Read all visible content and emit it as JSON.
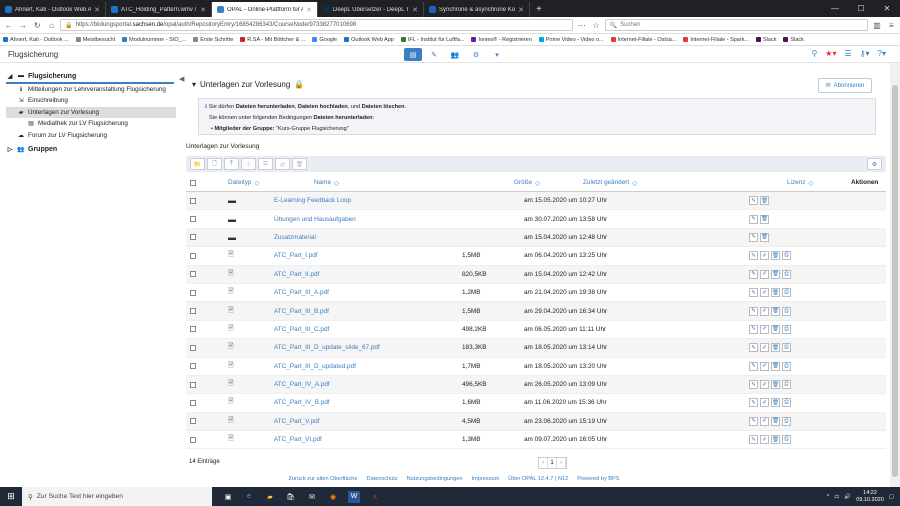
{
  "browser": {
    "tabs": [
      {
        "title": "Ahnert, Kati - Outlook Web Ap",
        "active": false,
        "color": "#1e73c8"
      },
      {
        "title": "ATC_Holding_Pattern.wmv / Mi",
        "active": false,
        "color": "#1976d2"
      },
      {
        "title": "OPAL - Online-Plattform für Ak",
        "active": true,
        "color": "#3a7fc1"
      },
      {
        "title": "DeepL Übersetzer - DeepL Tran",
        "active": false,
        "color": "#0f2b46"
      },
      {
        "title": "Synchrone & asynchrone Komm",
        "active": false,
        "color": "#1565c0"
      }
    ],
    "url_prefix": "https://bildungsportal.",
    "url_domain": "sachsen.de",
    "url_path": "/opal/auth/RepositoryEntry/16854286343/CourseNode/97338277010698",
    "search_placeholder": "Suchen",
    "bookmarks": [
      {
        "label": "Ahnert, Kati - Outlook ...",
        "color": "#1e73c8"
      },
      {
        "label": "Meistbesucht",
        "color": "#888888"
      },
      {
        "label": "Modulnummer - StO_...",
        "color": "#3a7fc1"
      },
      {
        "label": "Erste Schritte",
        "color": "#888888"
      },
      {
        "label": "R.SA - Mit Böttcher & ...",
        "color": "#c62828"
      },
      {
        "label": "Google",
        "color": "#4285f4"
      },
      {
        "label": "Outlook Web App",
        "color": "#1e73c8"
      },
      {
        "label": "IFL - Institut für Luftfa...",
        "color": "#2e7d32"
      },
      {
        "label": "Ionies® - Registrieren",
        "color": "#6a1b9a"
      },
      {
        "label": "Prime Video - Video o...",
        "color": "#00a8e1"
      },
      {
        "label": "Internet-Filiale - Ostsä...",
        "color": "#e53935"
      },
      {
        "label": "Internet-Filiale - Spark...",
        "color": "#e53935"
      },
      {
        "label": "Slack",
        "color": "#4a154b"
      },
      {
        "label": "Slack",
        "color": "#4a154b"
      }
    ]
  },
  "app": {
    "course_title": "Flugsicherung"
  },
  "sidebar": {
    "root": "Flugsicherung",
    "items": [
      {
        "label": "Mitteilungen zur Lehrveranstaltung Flugsicherung",
        "icon": "info-icon",
        "level": 1
      },
      {
        "label": "Einschreibung",
        "icon": "enroll-icon",
        "level": 1
      },
      {
        "label": "Unterlagen zur Vorlesung",
        "icon": "folder-icon",
        "level": 1,
        "selected": true
      },
      {
        "label": "Mediathek zur LV Flugsicherung",
        "icon": "media-icon",
        "level": 2
      },
      {
        "label": "Forum zur LV Flugsicherung",
        "icon": "forum-icon",
        "level": 1
      }
    ],
    "groups": "Gruppen"
  },
  "content": {
    "title": "Unterlagen zur Vorlesung",
    "subscribe_label": "Abonnieren",
    "info_line1_pre": "Sie dürfen ",
    "info_line1_b1": "Dateien herunterladen",
    "info_line1_sep1": ", ",
    "info_line1_b2": "Dateien hochladen",
    "info_line1_sep2": ", und ",
    "info_line1_b3": "Dateien löschen",
    "info_line1_end": ".",
    "info_line2_pre": "Sie können unter folgenden Bedingungen ",
    "info_line2_b": "Dateien herunterladen",
    "info_line2_end": ":",
    "info_line3_b": "Mitglieder der Gruppe:",
    "info_line3_rest": " \"Kurs-Gruppe Flugsicherung\"",
    "table_label": "Unterlagen zur Vorlesung",
    "columns": {
      "type": "Dateityp",
      "name": "Name",
      "size": "Größe",
      "date": "Zuletzt geändert",
      "license": "Lizenz",
      "actions": "Aktionen"
    },
    "rows": [
      {
        "type": "folder",
        "name": "E-Learning Feedback Loop",
        "size": "",
        "date": "am 15.05.2020 um 10:27 Uhr"
      },
      {
        "type": "folder",
        "name": "Übungen und Hausaufgaben",
        "size": "",
        "date": "am 30.07.2020 um 13:58 Uhr"
      },
      {
        "type": "folder",
        "name": "Zusatzmaterial",
        "size": "",
        "date": "am 15.04.2020 um 12:48 Uhr"
      },
      {
        "type": "pdf",
        "name": "ATC_Part_I.pdf",
        "size": "1,5MB",
        "date": "am 06.04.2020 um 13:25 Uhr"
      },
      {
        "type": "pdf",
        "name": "ATC_Part_II.pdf",
        "size": "820,5KB",
        "date": "am 15.04.2020 um 12:42 Uhr"
      },
      {
        "type": "pdf",
        "name": "ATC_Part_III_A.pdf",
        "size": "1,2MB",
        "date": "am 21.04.2020 um 19:38 Uhr"
      },
      {
        "type": "pdf",
        "name": "ATC_Part_III_B.pdf",
        "size": "1,5MB",
        "date": "am 29.04.2020 um 16:34 Uhr"
      },
      {
        "type": "pdf",
        "name": "ATC_Part_III_C.pdf",
        "size": "498,2KB",
        "date": "am 06.05.2020 um 11:11 Uhr"
      },
      {
        "type": "pdf",
        "name": "ATC_Part_III_D_update_slide_67.pdf",
        "size": "183,3KB",
        "date": "am 18.05.2020 um 13:14 Uhr"
      },
      {
        "type": "pdf",
        "name": "ATC_Part_III_D_updated.pdf",
        "size": "1,7MB",
        "date": "am 18.05.2020 um 13:20 Uhr"
      },
      {
        "type": "pdf",
        "name": "ATC_Part_IV_A.pdf",
        "size": "496,5KB",
        "date": "am 26.05.2020 um 13:09 Uhr"
      },
      {
        "type": "pdf",
        "name": "ATC_Part_IV_B.pdf",
        "size": "1,6MB",
        "date": "am 11.06.2020 um 15:36 Uhr"
      },
      {
        "type": "pdf",
        "name": "ATC_Part_V.pdf",
        "size": "4,5MB",
        "date": "am 23.06.2020 um 15:19 Uhr"
      },
      {
        "type": "pdf",
        "name": "ATC_Part_VI.pdf",
        "size": "1,3MB",
        "date": "am 09.07.2020 um 16:05 Uhr"
      }
    ],
    "entry_count": "14 Einträge",
    "pager": {
      "prev": "‹",
      "current": "1",
      "next": "›"
    }
  },
  "footer": [
    "Zurück zur alten Oberfläche",
    "Datenschutz",
    "Nutzungsbedingungen",
    "Impressum",
    "Über OPAL 12.4.7 | N12",
    "Powered by BPS"
  ],
  "taskbar": {
    "search_placeholder": "Zur Suche Text hier eingeben",
    "time": "14:22",
    "date": "09.10.2020"
  }
}
